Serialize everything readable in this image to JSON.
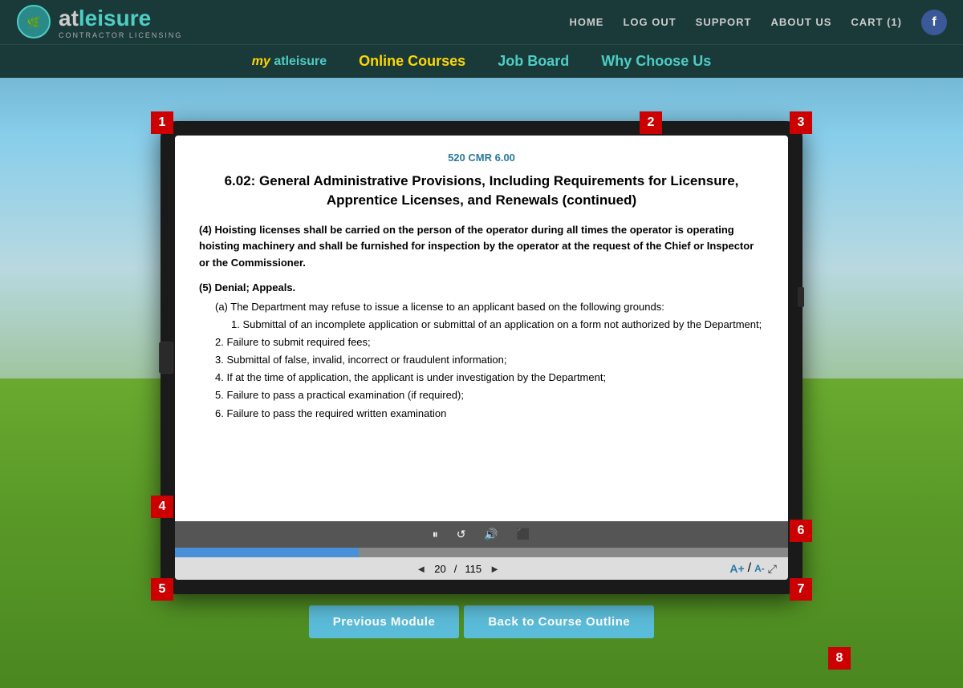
{
  "header": {
    "logo_text_at": "at",
    "logo_text_leisure": "leisure",
    "logo_subtitle": "CONTRACTOR LICENSING",
    "nav_top": {
      "home": "HOME",
      "logout": "LOG OUT",
      "support": "SUPPORT",
      "about_us": "ABOUT US",
      "cart": "CART (1)"
    },
    "nav_bottom": {
      "my": "my",
      "atleisure": "atleisure",
      "online_courses": "Online Courses",
      "job_board": "Job Board",
      "why_choose": "Why Choose Us"
    }
  },
  "document": {
    "regulation": "520 CMR 6.00",
    "title": "6.02: General Administrative Provisions, Including Requirements for Licensure, Apprentice Licenses, and Renewals (continued)",
    "paragraph_4": "(4) Hoisting licenses shall be carried on the person of the operator during all times the operator is operating hoisting machinery and shall be furnished for inspection by the operator at the request of the Chief or Inspector or the Commissioner.",
    "section_5_title": "(5) Denial; Appeals.",
    "section_5a": "(a) The Department may refuse to issue a license to an applicant based on the following grounds:",
    "item_1": "1. Submittal of an incomplete application or submittal of an application on a form not authorized by the Department;",
    "item_2": "2. Failure to submit required fees;",
    "item_3": "3. Submittal of false, invalid, incorrect or fraudulent information;",
    "item_4": "4. If at the time of application, the applicant is under investigation by the Department;",
    "item_5": "5. Failure to pass a practical examination (if required);",
    "item_6": "6. Failure to pass the required written examination"
  },
  "media_controls": {
    "pause_icon": "⏸",
    "rewind_icon": "↺",
    "volume_icon": "🔊",
    "screen_icon": "⬛"
  },
  "page_nav": {
    "prev_arrow": "◄",
    "current_page": "20",
    "total_pages": "115",
    "next_arrow": "►",
    "font_increase": "A+",
    "font_decrease": "A-",
    "font_separator": "/"
  },
  "badges": {
    "b1": "1",
    "b2": "2",
    "b3": "3",
    "b4": "4",
    "b5": "5",
    "b6": "6",
    "b7": "7",
    "b8": "8"
  },
  "buttons": {
    "previous_module": "Previous Module",
    "back_to_outline": "Back to Course Outline"
  },
  "progress": {
    "percent": 30
  }
}
